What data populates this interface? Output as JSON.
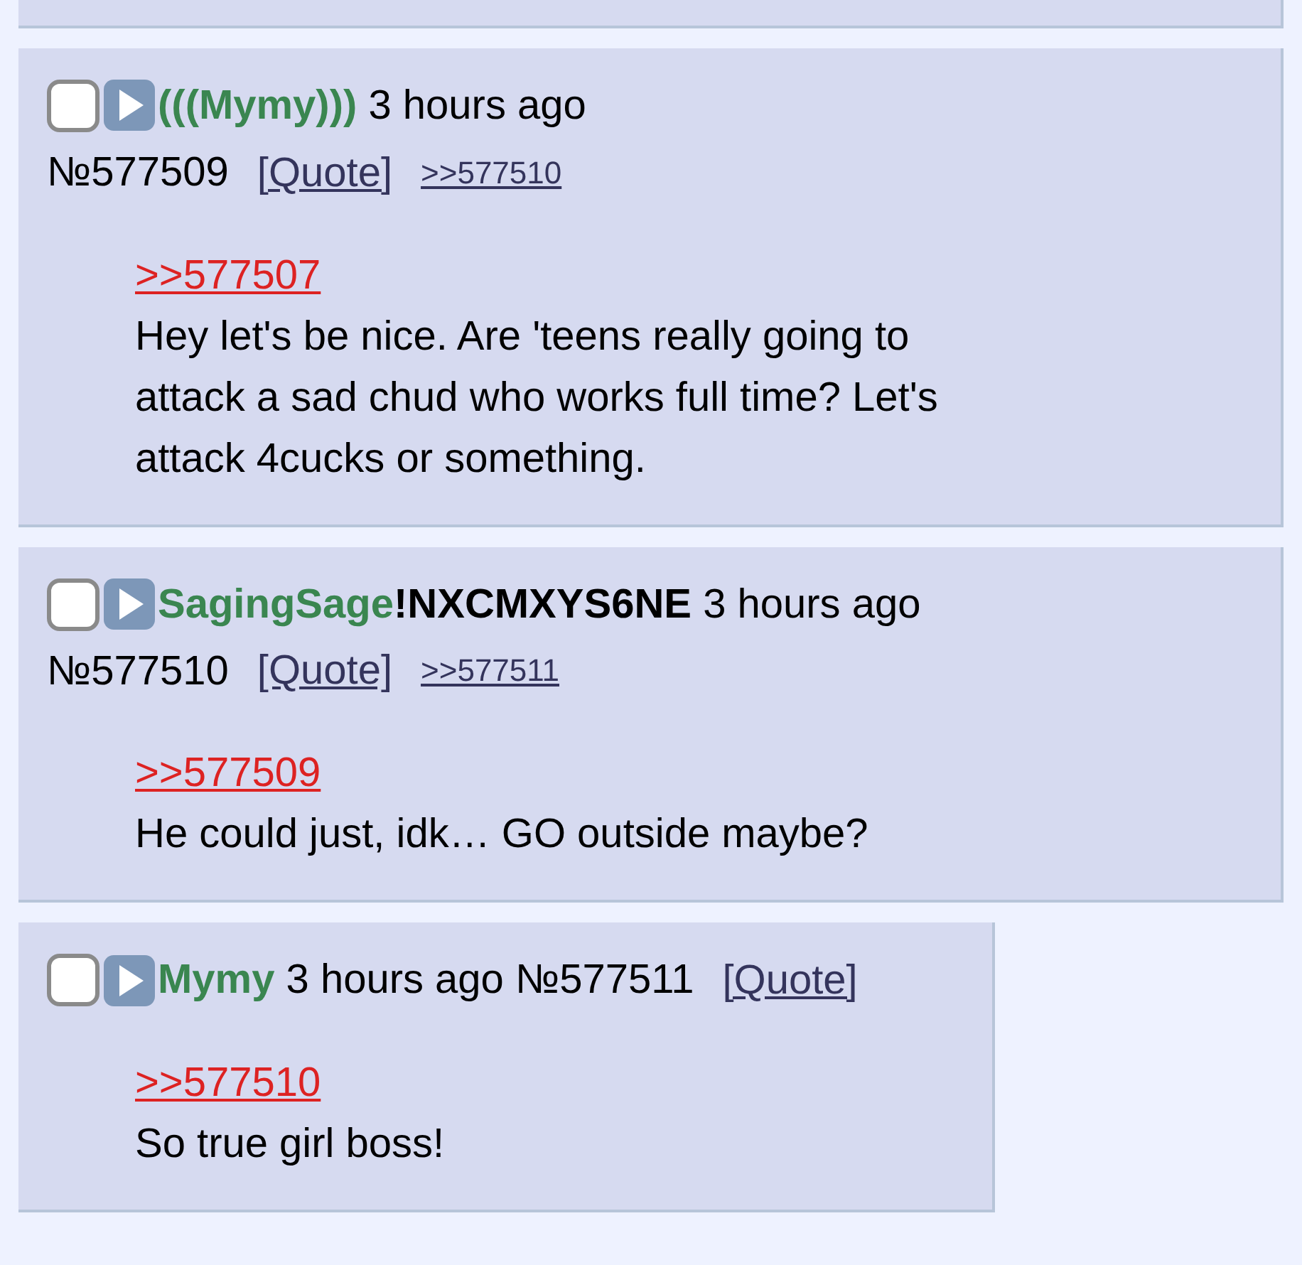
{
  "posts": [
    {
      "name": "(((Mymy)))",
      "time": "3 hours ago",
      "number": "№577509",
      "quote": "[Quote]",
      "backlinks": [
        ">>577510"
      ],
      "reply_to": ">>577507",
      "text": "Hey let's be nice. Are 'teens really going to attack a sad chud who works full time? Let's attack 4cucks or something.",
      "checked": false
    },
    {
      "name": "SagingSage",
      "tripcode": "!NXCMXYS6NE",
      "time": "3 hours ago",
      "number": "№577510",
      "quote": "[Quote]",
      "backlinks": [
        ">>577511"
      ],
      "reply_to": ">>577509",
      "text": "He could just, idk… GO outside maybe?",
      "checked": false
    },
    {
      "name": "Mymy",
      "time": "3 hours ago",
      "number": "№577511",
      "quote": "[Quote]",
      "reply_to": ">>577510",
      "text": "So true girl boss!",
      "checked": false
    }
  ]
}
